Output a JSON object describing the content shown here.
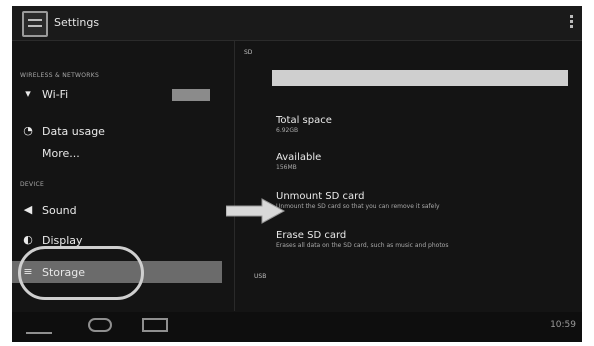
{
  "topbar": {
    "title": "Settings"
  },
  "left": {
    "sections": {
      "wireless": "WIRELESS & NETWORKS",
      "device": "DEVICE"
    },
    "items": [
      {
        "label": "Wi-Fi",
        "icon": "wifi-icon"
      },
      {
        "label": "Data usage",
        "icon": "data-usage-icon"
      },
      {
        "label": "More...",
        "icon": ""
      },
      {
        "label": "Sound",
        "icon": "speaker-icon"
      },
      {
        "label": "Display",
        "icon": "display-icon"
      },
      {
        "label": "Storage",
        "icon": "storage-icon"
      }
    ]
  },
  "right": {
    "sd_header": "SD",
    "usb_header": "USB",
    "entries": [
      {
        "title": "Total space",
        "summary": "6.92GB"
      },
      {
        "title": "Available",
        "summary": "156MB"
      },
      {
        "title": "Unmount SD card",
        "summary": "Unmount the SD card so that you can remove it safely"
      },
      {
        "title": "Erase SD card",
        "summary": "Erases all data on the SD card, such as music and photos"
      }
    ]
  },
  "statusbar": {
    "time": "10:59"
  },
  "colors": {
    "background": "#141414",
    "selected": "#6b6b6b",
    "accent": "#cfcfcf"
  }
}
